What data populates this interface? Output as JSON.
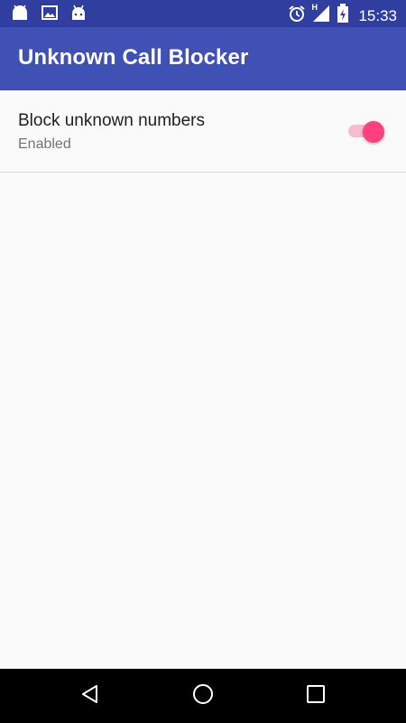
{
  "status_bar": {
    "time": "15:33",
    "network": "H",
    "left_icons": [
      "android-icon",
      "image-icon",
      "android-debug-icon"
    ],
    "right_icons": [
      "alarm-icon",
      "signal-icon",
      "battery-charging-icon"
    ]
  },
  "app_bar": {
    "title": "Unknown Call Blocker",
    "color": "#3F51B5"
  },
  "preference": {
    "title": "Block unknown numbers",
    "summary": "Enabled",
    "switch_on": true,
    "accent": "#FF4081"
  },
  "nav_bar": {
    "buttons": [
      "back-icon",
      "home-icon",
      "recents-icon"
    ]
  }
}
